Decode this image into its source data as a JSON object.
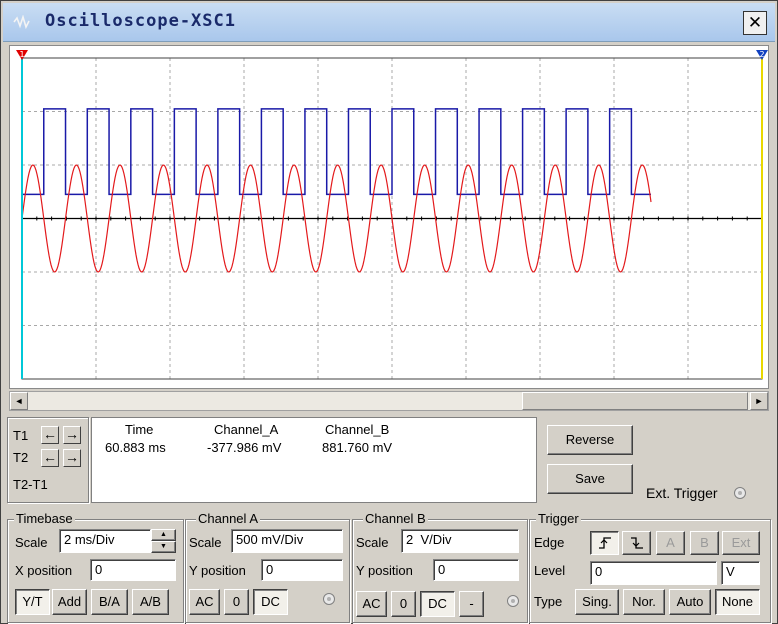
{
  "window": {
    "title": "Oscilloscope-XSC1",
    "close_label": "✕"
  },
  "colors": {
    "channel_a": "#e31a1c",
    "channel_b": "#1a1aa8",
    "cursor_1": "#00c8d8",
    "cursor_2": "#e8d800",
    "cursor_marker_1": "#e00000",
    "cursor_marker_2": "#1040c0"
  },
  "chart_data": {
    "type": "line",
    "xlabel": "",
    "ylabel": "",
    "x_divisions": 10,
    "y_divisions": 6,
    "grid": true,
    "series": [
      {
        "shape": "sine",
        "cycles_shown": 17,
        "amplitude_div": 1.0,
        "offset_div": 0.0,
        "visible_fraction": 0.85
      },
      {
        "shape": "square",
        "cycles_shown": 17,
        "low_div": 0.45,
        "high_div": 2.05,
        "duty": 0.5,
        "visible_fraction": 0.85
      }
    ]
  },
  "cursors": {
    "t1_label": "T1",
    "t2_label": "T2",
    "diff_label": "T2-T1",
    "t1_marker": "1",
    "t2_marker": "2",
    "left_arrow": "←",
    "right_arrow": "→"
  },
  "readout": {
    "headers": [
      "Time",
      "Channel_A",
      "Channel_B"
    ],
    "t1_values": [
      "60.883 ms",
      "-377.986 mV",
      "881.760 mV"
    ]
  },
  "actions": {
    "reverse_label": "Reverse",
    "save_label": "Save",
    "ext_trigger_label": "Ext. Trigger"
  },
  "timebase": {
    "title": "Timebase",
    "scale_label": "Scale",
    "scale_value": "2 ms/Div",
    "xpos_label": "X position",
    "xpos_value": "0",
    "modes": [
      "Y/T",
      "Add",
      "B/A",
      "A/B"
    ]
  },
  "channel_a": {
    "title": "Channel A",
    "scale_label": "Scale",
    "scale_value": "500 mV/Div",
    "ypos_label": "Y position",
    "ypos_value": "0",
    "coupling": [
      "AC",
      "0",
      "DC"
    ]
  },
  "channel_b": {
    "title": "Channel B",
    "scale_label": "Scale",
    "scale_value": "2  V/Div",
    "ypos_label": "Y position",
    "ypos_value": "0",
    "coupling": [
      "AC",
      "0",
      "DC",
      "-"
    ]
  },
  "trigger": {
    "title": "Trigger",
    "edge_label": "Edge",
    "level_label": "Level",
    "level_value": "0",
    "level_unit": "V",
    "type_label": "Type",
    "sources": [
      "A",
      "B",
      "Ext"
    ],
    "types": [
      "Sing.",
      "Nor.",
      "Auto",
      "None"
    ]
  },
  "scroll": {
    "left": "◄",
    "right": "►"
  }
}
